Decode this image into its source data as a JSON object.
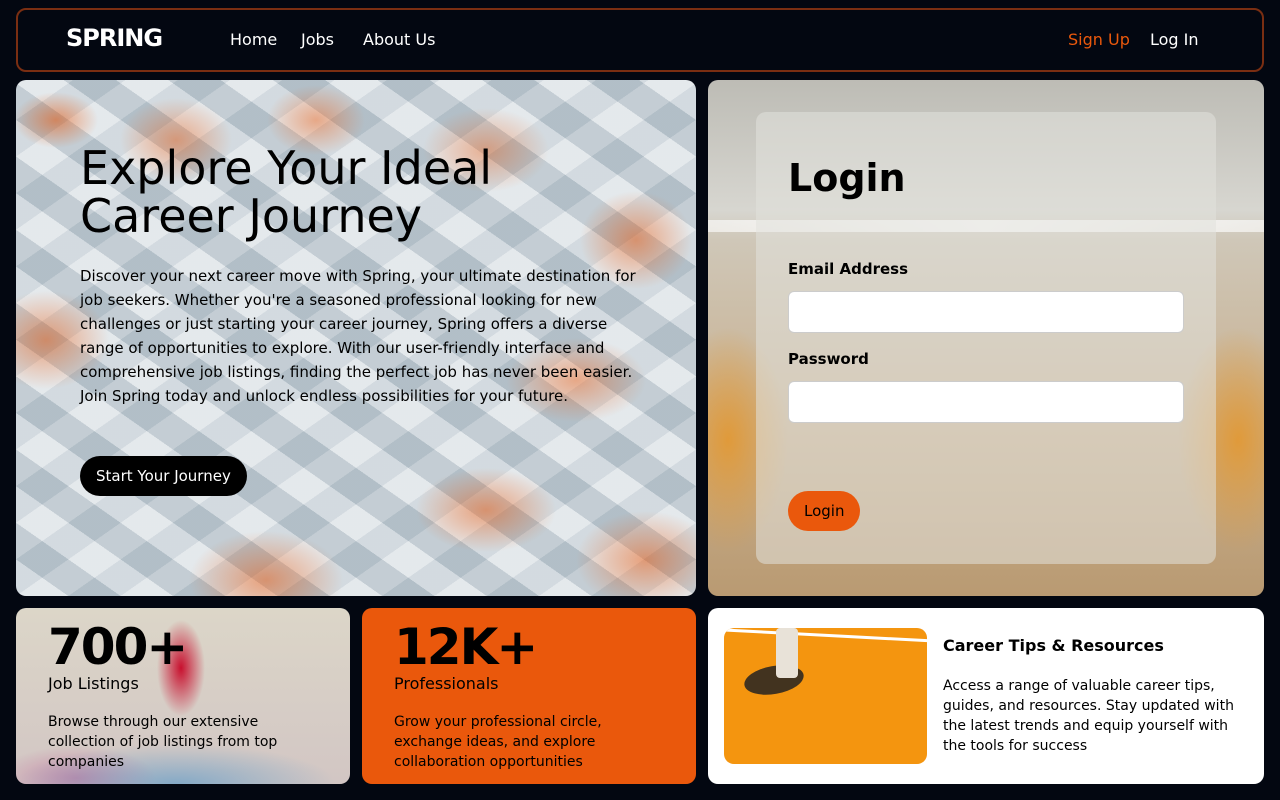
{
  "nav": {
    "logo": "SPRING",
    "links": [
      "Home",
      "Jobs",
      "About Us"
    ],
    "signup": "Sign Up",
    "login": "Log In"
  },
  "hero": {
    "title": "Explore Your Ideal Career Journey",
    "description": "Discover your next career move with Spring, your ultimate destination for job seekers. Whether you're a seasoned professional looking for new challenges or just starting your career journey, Spring offers a diverse range of opportunities to explore. With our user-friendly interface and comprehensive job listings, finding the perfect job has never been easier. Join Spring today and unlock endless possibilities for your future.",
    "button": "Start Your Journey"
  },
  "login": {
    "title": "Login",
    "email_label": "Email Address",
    "email_value": "",
    "password_label": "Password",
    "password_value": "",
    "button": "Login"
  },
  "stats": [
    {
      "number": "700+",
      "label": "Job Listings",
      "description": "Browse through our extensive collection of job listings from top companies"
    },
    {
      "number": "12K+",
      "label": "Professionals",
      "description": "Grow your professional circle, exchange ideas, and explore collaboration opportunities"
    }
  ],
  "tips": {
    "title": "Career Tips & Resources",
    "description": "Access a range of valuable career tips, guides, and resources. Stay updated with the latest trends and equip yourself with the tools for success"
  },
  "colors": {
    "accent": "#ea580c",
    "background": "#030711"
  }
}
